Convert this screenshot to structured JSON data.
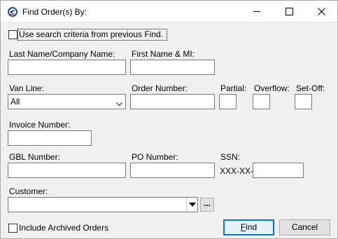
{
  "window": {
    "title": "Find Order(s) By:",
    "icon": "app-logo-icon",
    "controls": [
      "minimize-icon",
      "maximize-icon",
      "close-icon"
    ]
  },
  "use_previous": {
    "label": "Use search criteria from previous Find.",
    "checked": false
  },
  "fields": {
    "last_name_label": "Last Name/Company Name:",
    "first_name_label": "First Name & MI:",
    "van_line_label": "Van Line:",
    "van_line_value": "All",
    "order_number_label": "Order Number:",
    "partial_label": "Partial:",
    "overflow_label": "Overflow:",
    "setoff_label": "Set-Off:",
    "invoice_label": "Invoice Number:",
    "gbl_label": "GBL Number:",
    "po_label": "PO Number:",
    "ssn_label": "SSN:",
    "ssn_prefix": "XXX-XX-",
    "customer_label": "Customer:",
    "customer_button": "..."
  },
  "include_archived": {
    "label": "Include Archived Orders",
    "checked": false
  },
  "buttons": {
    "find": "Find",
    "cancel": "Cancel"
  }
}
